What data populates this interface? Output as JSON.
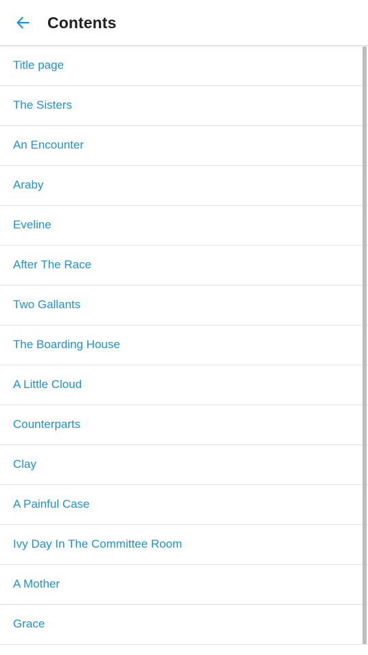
{
  "appbar": {
    "back_icon": "arrow-left-icon",
    "title": "Contents"
  },
  "colors": {
    "accent_blue": "#1d93cd",
    "title_text": "#212121",
    "divider": "#e2e3e4",
    "scrollbar": "#bdbdbd",
    "background": "#ffffff"
  },
  "contents": {
    "items": [
      {
        "label": "Title page"
      },
      {
        "label": "The Sisters"
      },
      {
        "label": "An Encounter"
      },
      {
        "label": "Araby"
      },
      {
        "label": "Eveline"
      },
      {
        "label": "After The Race"
      },
      {
        "label": "Two Gallants"
      },
      {
        "label": "The Boarding House"
      },
      {
        "label": "A Little Cloud"
      },
      {
        "label": "Counterparts"
      },
      {
        "label": "Clay"
      },
      {
        "label": "A Painful Case"
      },
      {
        "label": "Ivy Day In The Committee Room"
      },
      {
        "label": "A Mother"
      },
      {
        "label": "Grace"
      }
    ]
  },
  "scrollbar": {
    "visible": true,
    "position": "right"
  }
}
